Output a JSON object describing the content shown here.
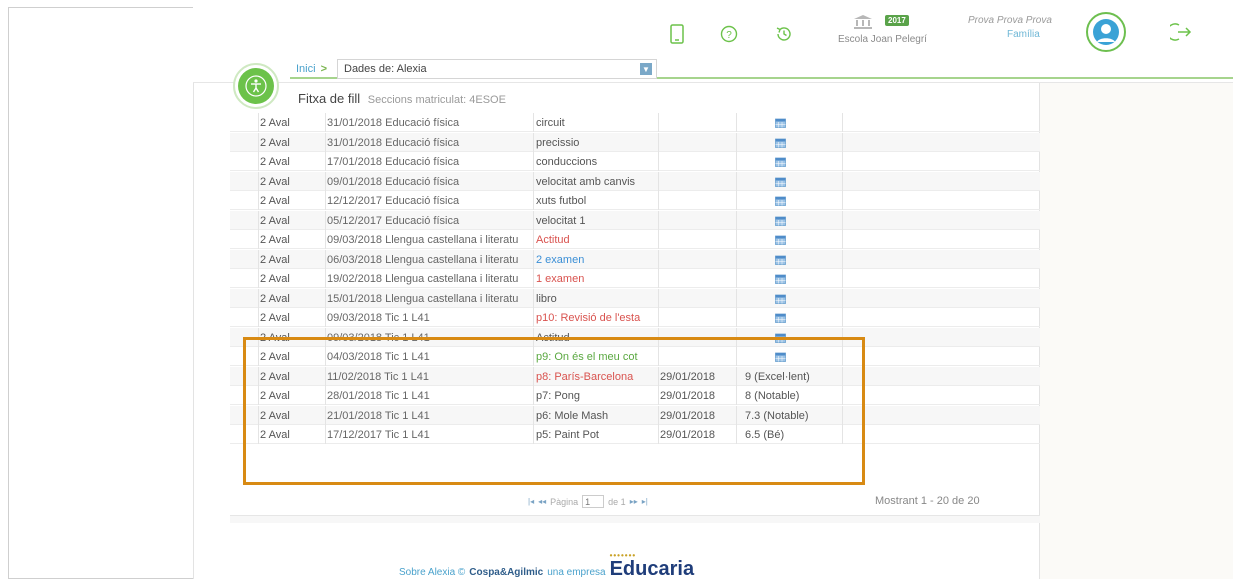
{
  "header": {
    "school_year": "2017",
    "school_name": "Escola Joan Pelegrí",
    "user_name": "Prova Prova Prova",
    "user_role": "Família"
  },
  "breadcrumb": {
    "home": "Inici",
    "separator": ">",
    "selector_label": "Dades de:",
    "selector_value": "Alexia"
  },
  "page": {
    "title": "Fitxa de fill",
    "subtitle": "Seccions matriculat: 4ESOE"
  },
  "rows": [
    {
      "aval": "2 Aval",
      "date_subject": "31/01/2018 Educació física",
      "activity": "circuit",
      "act_color": "",
      "fdate": "",
      "note": "",
      "icon": true
    },
    {
      "aval": "2 Aval",
      "date_subject": "31/01/2018 Educació física",
      "activity": "precissio",
      "act_color": "",
      "fdate": "",
      "note": "",
      "icon": true
    },
    {
      "aval": "2 Aval",
      "date_subject": "17/01/2018 Educació física",
      "activity": "conduccions",
      "act_color": "",
      "fdate": "",
      "note": "",
      "icon": true
    },
    {
      "aval": "2 Aval",
      "date_subject": "09/01/2018 Educació física",
      "activity": "velocitat amb canvis",
      "act_color": "",
      "fdate": "",
      "note": "",
      "icon": true
    },
    {
      "aval": "2 Aval",
      "date_subject": "12/12/2017 Educació física",
      "activity": "xuts futbol",
      "act_color": "",
      "fdate": "",
      "note": "",
      "icon": true
    },
    {
      "aval": "2 Aval",
      "date_subject": "05/12/2017 Educació física",
      "activity": "velocitat 1",
      "act_color": "",
      "fdate": "",
      "note": "",
      "icon": true
    },
    {
      "aval": "2 Aval",
      "date_subject": "09/03/2018 Llengua castellana i literatu",
      "activity": "Actitud",
      "act_color": "red",
      "fdate": "",
      "note": "",
      "icon": true
    },
    {
      "aval": "2 Aval",
      "date_subject": "06/03/2018 Llengua castellana i literatu",
      "activity": "2 examen",
      "act_color": "blue",
      "fdate": "",
      "note": "",
      "icon": true
    },
    {
      "aval": "2 Aval",
      "date_subject": "19/02/2018 Llengua castellana i literatu",
      "activity": "1 examen",
      "act_color": "red",
      "fdate": "",
      "note": "",
      "icon": true
    },
    {
      "aval": "2 Aval",
      "date_subject": "15/01/2018 Llengua castellana i literatu",
      "activity": "libro",
      "act_color": "",
      "fdate": "",
      "note": "",
      "icon": true
    },
    {
      "aval": "2 Aval",
      "date_subject": "09/03/2018 Tic 1 L41",
      "activity": "p10: Revisió de l'esta",
      "act_color": "red",
      "fdate": "",
      "note": "",
      "icon": true
    },
    {
      "aval": "2 Aval",
      "date_subject": "09/03/2018 Tic 1 L41",
      "activity": "Actitud",
      "act_color": "",
      "fdate": "",
      "note": "",
      "icon": true
    },
    {
      "aval": "2 Aval",
      "date_subject": "04/03/2018 Tic 1 L41",
      "activity": "p9: On és el meu cot",
      "act_color": "green",
      "fdate": "",
      "note": "",
      "icon": true
    },
    {
      "aval": "2 Aval",
      "date_subject": "11/02/2018 Tic 1 L41",
      "activity": "p8: París-Barcelona",
      "act_color": "red",
      "fdate": "29/01/2018",
      "note": "9 (Excel·lent)",
      "icon": false
    },
    {
      "aval": "2 Aval",
      "date_subject": "28/01/2018 Tic 1 L41",
      "activity": "p7: Pong",
      "act_color": "",
      "fdate": "29/01/2018",
      "note": "8 (Notable)",
      "icon": false
    },
    {
      "aval": "2 Aval",
      "date_subject": "21/01/2018 Tic 1 L41",
      "activity": "p6: Mole Mash",
      "act_color": "",
      "fdate": "29/01/2018",
      "note": "7.3 (Notable)",
      "icon": false
    },
    {
      "aval": "2 Aval",
      "date_subject": "17/12/2017 Tic 1 L41",
      "activity": "p5: Paint Pot",
      "act_color": "",
      "fdate": "29/01/2018",
      "note": "6.5 (Bé)",
      "icon": false
    }
  ],
  "pager": {
    "page_label": "Pàgina",
    "page_value": "1",
    "of_label": "de 1",
    "showing": "Mostrant 1 - 20 de 20"
  },
  "footer": {
    "about": "Sobre Alexia ©",
    "company": "Cospa&Agilmic",
    "tagline": "una empresa",
    "brand": "Educaria"
  },
  "colors": {
    "accent_green": "#6cc24a",
    "link_blue": "#4aa2cc",
    "highlight_orange": "#d88a13"
  }
}
